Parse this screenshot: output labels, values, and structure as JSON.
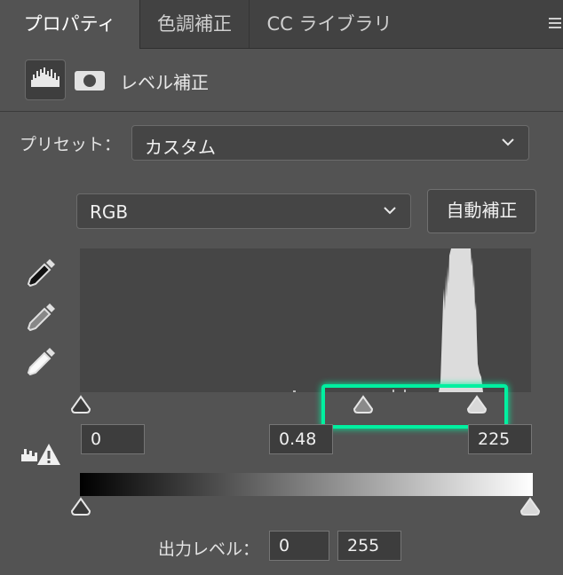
{
  "tabs": [
    {
      "label": "プロパティ",
      "active": true
    },
    {
      "label": "色調補正",
      "active": false
    },
    {
      "label": "CC ライブラリ",
      "active": false
    }
  ],
  "header": {
    "title": "レベル補正",
    "icon": "levels-adjustment-icon",
    "mask_icon": "layer-mask-icon"
  },
  "preset": {
    "label": "プリセット：",
    "value": "カスタム"
  },
  "channel": {
    "value": "RGB"
  },
  "auto_button": "自動補正",
  "input_levels": {
    "black": "0",
    "gamma": "0.48",
    "white": "225"
  },
  "output_levels": {
    "label": "出力レベル：",
    "black": "0",
    "white": "255"
  },
  "highlight_color": "#00f0a0"
}
